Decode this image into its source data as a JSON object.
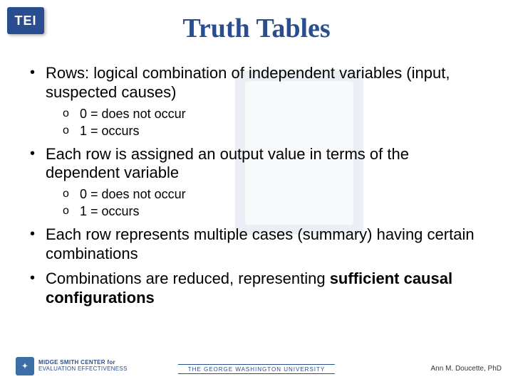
{
  "logo": {
    "text": "TEI"
  },
  "title": "Truth Tables",
  "bullets": [
    {
      "text": "Rows: logical combination of independent variables (input, suspected causes)",
      "sub": [
        {
          "text": "0 = does not occur"
        },
        {
          "text": "1 = occurs"
        }
      ]
    },
    {
      "text": "Each row is assigned an output value in terms of the dependent variable",
      "sub": [
        {
          "text": "0 = does not occur"
        },
        {
          "text": "1 = occurs"
        }
      ]
    },
    {
      "text": "Each row represents multiple cases (summary) having certain combinations"
    },
    {
      "text_prefix": "Combinations are reduced, representing ",
      "text_bold": "sufficient causal configurations"
    }
  ],
  "footer": {
    "left_line1": "MIDGE SMITH CENTER for",
    "left_line2": "EVALUATION EFFECTIVENESS",
    "center": "THE GEORGE WASHINGTON UNIVERSITY",
    "right": "Ann M. Doucette, PhD",
    "page": ""
  }
}
